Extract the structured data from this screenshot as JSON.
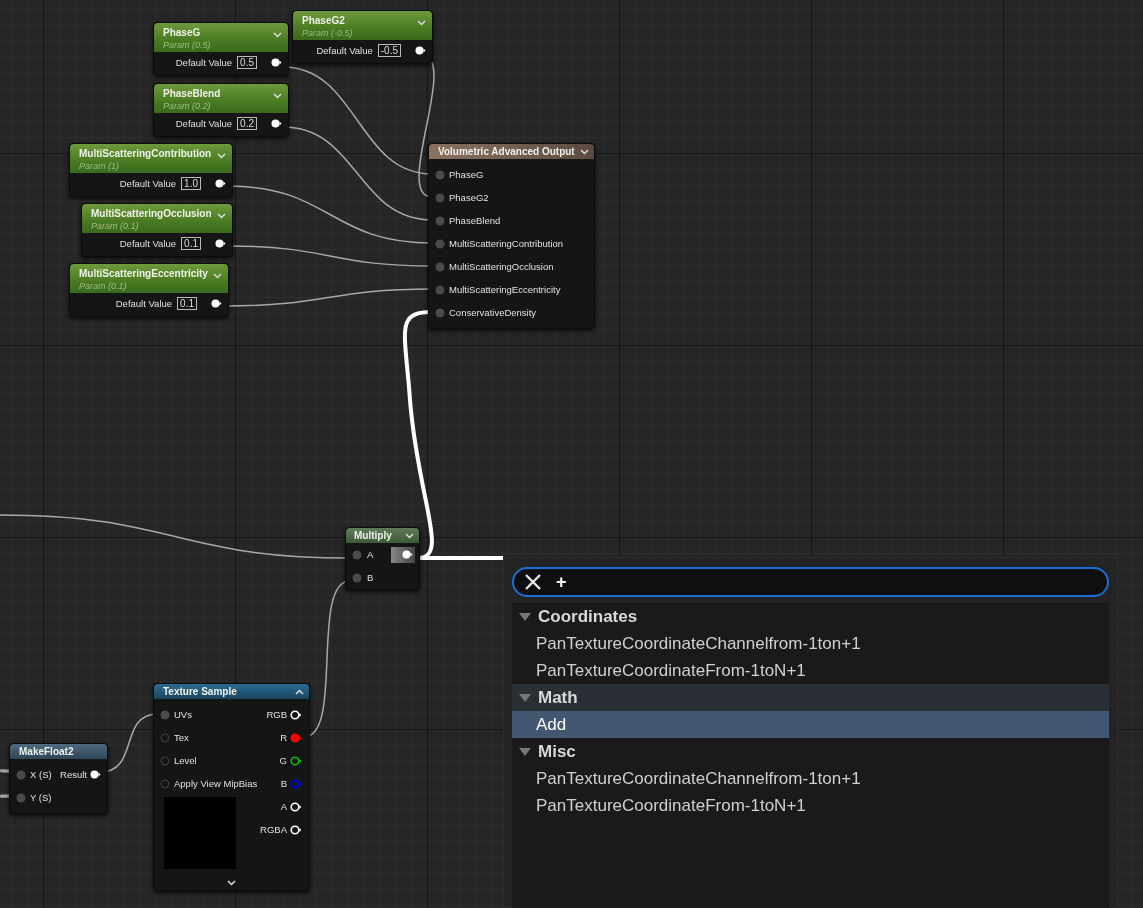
{
  "nodes": [
    {
      "kind": "param",
      "title": "PhaseG",
      "subtitle": "Param (0.5)",
      "label": "Default Value",
      "value": "0.5"
    },
    {
      "kind": "param",
      "title": "PhaseG2",
      "subtitle": "Param (-0.5)",
      "label": "Default Value",
      "value": "-0.5"
    },
    {
      "kind": "param",
      "title": "PhaseBlend",
      "subtitle": "Param (0.2)",
      "label": "Default Value",
      "value": "0.2"
    },
    {
      "kind": "param",
      "title": "MultiScatteringContribution",
      "subtitle": "Param (1)",
      "label": "Default Value",
      "value": "1.0"
    },
    {
      "kind": "param",
      "title": "MultiScatteringOcclusion",
      "subtitle": "Param (0.1)",
      "label": "Default Value",
      "value": "0.1"
    },
    {
      "kind": "param",
      "title": "MultiScatteringEccentricity",
      "subtitle": "Param (0.1)",
      "label": "Default Value",
      "value": "0.1"
    },
    {
      "kind": "output",
      "title": "Volumetric Advanced Output",
      "inputs": [
        "PhaseG",
        "PhaseG2",
        "PhaseBlend",
        "MultiScatteringContribution",
        "MultiScatteringOcclusion",
        "MultiScatteringEccentricity",
        "ConservativeDensity"
      ]
    },
    {
      "kind": "math",
      "title": "Multiply",
      "inputs": [
        "A",
        "B"
      ]
    },
    {
      "kind": "texture",
      "title": "Texture Sample",
      "inputs": [
        {
          "label": "UVs",
          "connected": true
        },
        {
          "label": "Tex",
          "connected": false
        },
        {
          "label": "Level",
          "connected": false
        },
        {
          "label": "Apply View MipBias",
          "connected": false
        }
      ],
      "outputs": [
        {
          "label": "RGB",
          "color": "#ffffff",
          "connected": false
        },
        {
          "label": "R",
          "color": "#ff0000",
          "connected": true
        },
        {
          "label": "G",
          "color": "#00c800",
          "connected": false
        },
        {
          "label": "B",
          "color": "#0000ff",
          "connected": false
        },
        {
          "label": "A",
          "color": "#ffffff",
          "connected": false
        },
        {
          "label": "RGBA",
          "color": "#ffffff",
          "connected": false
        }
      ]
    },
    {
      "kind": "make",
      "title": "MakeFloat2",
      "inputs": [
        "X (S)",
        "Y (S)"
      ],
      "output": "Result"
    }
  ],
  "menu": {
    "search": {
      "value": "+"
    },
    "categories": [
      {
        "name": "Coordinates",
        "expanded": true,
        "items": [
          {
            "label": "PanTextureCoordinateChannelfrom-1ton+1",
            "selected": false
          },
          {
            "label": "PanTextureCoordinateFrom-1toN+1",
            "selected": false
          }
        ]
      },
      {
        "name": "Math",
        "expanded": true,
        "items": [
          {
            "label": "Add",
            "selected": true
          }
        ]
      },
      {
        "name": "Misc",
        "expanded": true,
        "items": [
          {
            "label": "PanTextureCoordinateChannelfrom-1ton+1",
            "selected": false
          },
          {
            "label": "PanTextureCoordinateFrom-1toN+1",
            "selected": false
          }
        ]
      }
    ]
  }
}
